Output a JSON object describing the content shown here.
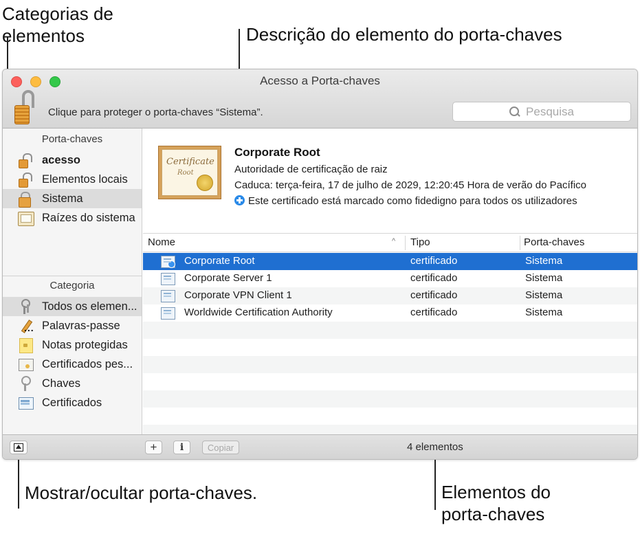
{
  "callouts": {
    "categories": [
      "Categorias de",
      "elementos"
    ],
    "description": "Descrição do elemento do porta-chaves",
    "show_hide": "Mostrar/ocultar porta-chaves.",
    "items": [
      "Elementos do",
      "porta-chaves"
    ]
  },
  "window": {
    "title": "Acesso a Porta-chaves",
    "lock_message": "Clique para proteger o porta-chaves “Sistema”.",
    "search_placeholder": "Pesquisa"
  },
  "sidebar": {
    "keychains_header": "Porta-chaves",
    "keychains": [
      {
        "label": "acesso",
        "icon": "unlocked-lock-icon"
      },
      {
        "label": "Elementos locais",
        "icon": "unlocked-lock-icon"
      },
      {
        "label": "Sistema",
        "icon": "locked-lock-icon",
        "selected": true
      },
      {
        "label": "Raízes do sistema",
        "icon": "cabinet-icon"
      }
    ],
    "category_header": "Categoria",
    "categories": [
      {
        "label": "Todos os elemen...",
        "icon": "keys-icon",
        "selected": true
      },
      {
        "label": "Palavras-passe",
        "icon": "pencil-icon"
      },
      {
        "label": "Notas protegidas",
        "icon": "secure-note-icon"
      },
      {
        "label": "Certificados pes...",
        "icon": "certificate-icon"
      },
      {
        "label": "Chaves",
        "icon": "key-icon"
      },
      {
        "label": "Certificados",
        "icon": "certificate-icon"
      }
    ]
  },
  "detail": {
    "cert_word1": "Certificate",
    "cert_word2": "Root",
    "name": "Corporate Root",
    "kind": "Autoridade de certificação de raiz",
    "expires": "Caduca: terça-feira, 17 de julho de 2029, 12:20:45 Hora de verão do Pacífico",
    "trust": "Este certificado está marcado como fidedigno para todos os utilizadores"
  },
  "table": {
    "columns": {
      "name": "Nome",
      "type": "Tipo",
      "keychain": "Porta-chaves"
    },
    "sort_indicator": "^",
    "rows": [
      {
        "name": "Corporate Root",
        "type": "certificado",
        "keychain": "Sistema",
        "selected": true
      },
      {
        "name": "Corporate Server 1",
        "type": "certificado",
        "keychain": "Sistema"
      },
      {
        "name": "Corporate VPN Client 1",
        "type": "certificado",
        "keychain": "Sistema"
      },
      {
        "name": "Worldwide Certification Authority",
        "type": "certificado",
        "keychain": "Sistema"
      }
    ]
  },
  "bottom": {
    "add_label": "+",
    "info_label": "i",
    "copy_label": "Copiar",
    "count": "4 elementos"
  },
  "colors": {
    "selection": "#1f6fd1",
    "trust_icon": "#2a8ae8"
  }
}
